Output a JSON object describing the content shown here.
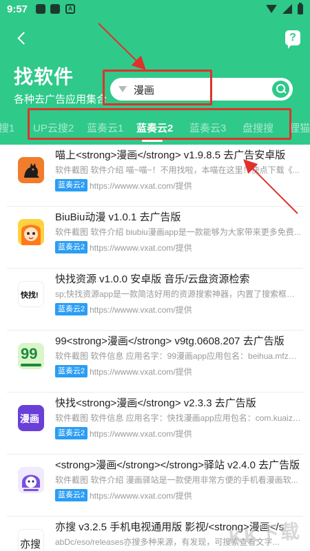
{
  "statusbar": {
    "time": "9:57",
    "notif_a": "A"
  },
  "header": {
    "title": "找软件",
    "subtitle": "各种去广告应用集合",
    "help_label": "?"
  },
  "search": {
    "value": "漫画",
    "placeholder": ""
  },
  "tabs": [
    {
      "label": "搜1",
      "active": false
    },
    {
      "label": "UP云搜2",
      "active": false
    },
    {
      "label": "蓝奏云1",
      "active": false
    },
    {
      "label": "蓝奏云2",
      "active": true
    },
    {
      "label": "蓝奏云3",
      "active": false
    },
    {
      "label": "盘搜搜",
      "active": false
    },
    {
      "label": "狸猫",
      "active": false
    }
  ],
  "results": [
    {
      "title": "喵上<strong>漫画</strong> v1.9.8.5 去广告安卓版",
      "desc": "软件截图 软件介绍 喵~喵~！不用找啦，本喵在这里！快点下载《...",
      "badge": "蓝奏云2",
      "source": "https://wwww.vxat.com/提供",
      "icon": "cat-app-icon"
    },
    {
      "title": "BiuBiu动漫 v1.0.1 去广告版",
      "desc": "软件截图 软件介绍 biubiu漫画app是一款能够为大家带来更多免费...",
      "badge": "蓝奏云2",
      "source": "https://wwww.vxat.com/提供",
      "icon": "anime-girl-app-icon"
    },
    {
      "title": "快找资源 v1.0.0 安卓版 音乐/云盘资源检索",
      "desc": "sp;快找资源app是一款简洁好用的资源搜索神器，内置了搜索框，...",
      "badge": "蓝奏云2",
      "source": "https://wwww.vxat.com/提供",
      "icon": "kuaizhao-app-icon",
      "icon_text": "快找!"
    },
    {
      "title": "99<strong>漫画</strong> v9tg.0608.207 去广告版",
      "desc": "软件截图 软件信息 应用名字：99漫画app应用包名：beihua.mfzm...",
      "badge": "蓝奏云2",
      "source": "https://wwww.vxat.com/提供",
      "icon": "99-manhua-app-icon",
      "icon_text": "99"
    },
    {
      "title": "快找<strong>漫画</strong> v2.3.3 去广告版",
      "desc": "软件截图 软件信息 应用名字：快找漫画app应用包名：com.kuaizh...",
      "badge": "蓝奏云2",
      "source": "https://wwww.vxat.com/提供",
      "icon": "kuaizhao-manhua-app-icon",
      "icon_text": "漫画"
    },
    {
      "title": "<strong>漫画</strong></strong>驿站 v2.4.0 去广告版",
      "desc": "软件截图 软件介绍 漫画驿站是一款使用非常方便的手机看漫画软...",
      "badge": "蓝奏云2",
      "source": "https://wwww.vxat.com/提供",
      "icon": "manhua-yizhan-app-icon"
    },
    {
      "title": "亦搜 v3.2.5 手机电视通用版 影视/<strong>漫画</s",
      "desc": "abDc/eso/releases亦搜多种来源，有发现，可搜索查看文字...",
      "badge": "",
      "source": "",
      "icon": "yisou-app-icon",
      "icon_text": "亦搜"
    }
  ],
  "watermark": "KK下载",
  "colors": {
    "brand": "#2fc98a",
    "badge": "#2a9df4",
    "highlight": "#e0312b"
  }
}
